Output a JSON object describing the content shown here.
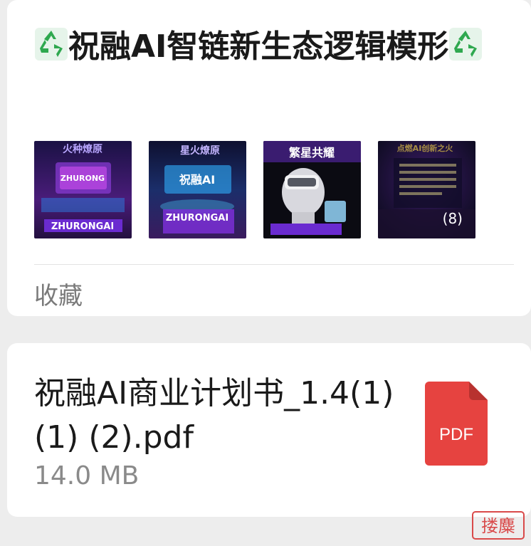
{
  "note_card": {
    "title_emoji": "♻️",
    "title_text": "祝融AI智链新生态逻辑模形",
    "thumbnails": [
      {
        "caption_top": "火种燎原",
        "caption_mid": "ZHURONG",
        "caption_bottom": "ZHURONGAI"
      },
      {
        "caption_top": "星火燎原",
        "caption_mid": "祝融AI",
        "caption_bottom": "ZHURONGAI"
      },
      {
        "caption_top": "繁星共耀",
        "caption_mid": "",
        "caption_bottom": ""
      },
      {
        "caption_top": "点燃AI创新之火",
        "caption_mid": "",
        "caption_bottom": ""
      }
    ],
    "more_count": "(8)",
    "footer_label": "收藏"
  },
  "file_card": {
    "file_name": "祝融AI商业计划书_1.4(1) (1) (2).pdf",
    "file_size": "14.0 MB",
    "file_type_label": "PDF"
  },
  "watermark_text": "搂麋",
  "colors": {
    "recycle_green": "#2fa84f",
    "pdf_red": "#e64340",
    "pdf_fold": "#b8322f",
    "watermark_red": "#d94a4a"
  }
}
